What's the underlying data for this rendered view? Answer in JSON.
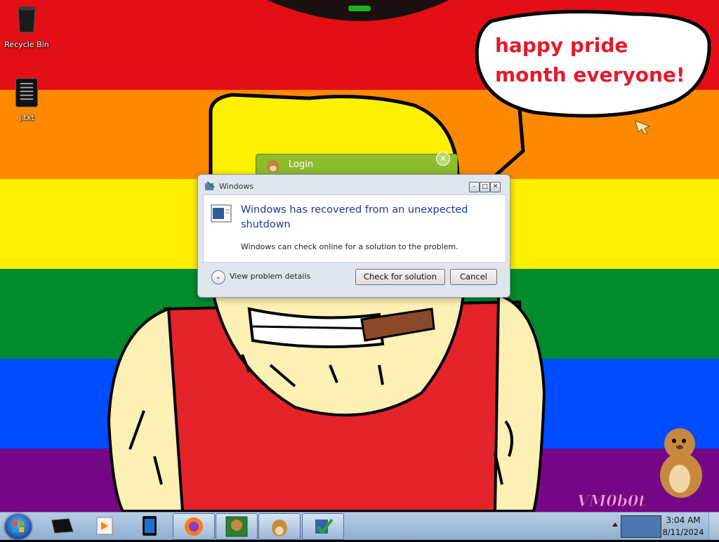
{
  "desktop": {
    "icons": [
      {
        "label": "Recycle Bin",
        "icon": "recycle-bin-icon"
      },
      {
        "label": "j.txt",
        "icon": "text-file-icon"
      }
    ],
    "speech_bubble": "happy pride month everyone!"
  },
  "login_window": {
    "title": "Login",
    "close_glyph": "✕"
  },
  "dialog": {
    "title": "Windows",
    "heading": "Windows has recovered from an unexpected shutdown",
    "message": "Windows can check online for a solution to the problem.",
    "details_label": "View problem details",
    "check_button": "Check for solution",
    "cancel_button": "Cancel",
    "controls": {
      "minimize": "–",
      "maximize": "□",
      "close": "✕"
    }
  },
  "taskbar": {
    "start": "start-orb",
    "pinned": [
      "terminal-app-icon",
      "media-player-icon",
      "tablet-app-icon",
      "firefox-icon"
    ],
    "running": [
      "box-app-icon",
      "hamster-app-icon",
      "check-app-icon"
    ],
    "tray": {
      "time": "3:04 AM",
      "date": "8/11/2024"
    }
  },
  "watermark": "VM0b0t",
  "colors": {
    "rainbow": [
      "#e30f16",
      "#ff8a00",
      "#fff000",
      "#008b2d",
      "#004cff",
      "#750787"
    ],
    "bubble_text": "#e21b2b",
    "dialog_heading": "#1a3a8f",
    "login_bar": "#8fbb2e"
  }
}
